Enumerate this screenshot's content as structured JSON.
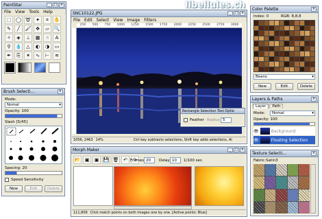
{
  "watermark": "libellules.ch",
  "paintstar": {
    "title": "PaintStar",
    "menus": [
      "File",
      "View",
      "Tools",
      "Help"
    ]
  },
  "image_window": {
    "title": "SNC10122.JPG",
    "menus": [
      "File",
      "Edit",
      "Select",
      "View",
      "Image",
      "Filters"
    ],
    "ruler": [
      "250",
      "500",
      "750",
      "1000",
      "1250",
      "1500",
      "1750",
      "2000",
      "2250",
      "2500",
      "2750",
      "3000"
    ],
    "status_coords": "1056, 2463",
    "status_zoom": "14%",
    "status_hint": "Ctrl key subtracts selections, Shift key adds selections, Al"
  },
  "rect_panel": {
    "title": "Rectangle Selection Tool Optio",
    "feather_label": "Feather",
    "radius_label": "Radius",
    "radius_value": "5"
  },
  "brush": {
    "title": "Brush Selecti...",
    "mode_label": "Mode:",
    "mode_value": "Nomal",
    "opacity_label": "Opacity: 100",
    "slash_label": "Slash [5/45]",
    "spacing_label": "Spacing: 20",
    "speed_label": "Speed Sensitivity",
    "new": "New",
    "edit": "Edit",
    "delete": "Delete"
  },
  "color_palette": {
    "title": "Color Palette",
    "index_label": "Index: 0",
    "rgb_label": "RGB: 8,8,8",
    "select_value": "Beans",
    "new": "New",
    "edit": "Edit",
    "delete": "Delete"
  },
  "layers": {
    "title": "Layers & Paths",
    "tabs": [
      "Layer",
      "Path"
    ],
    "mode_label": "Mode:",
    "mode_value": "Nomal",
    "opacity_label": "Opacity: 100",
    "items": [
      "Background",
      "Floating Selection"
    ]
  },
  "texture": {
    "title": "Texture Selecti...",
    "name": "Fabric:Satin3"
  },
  "morph": {
    "title": "Morph Maker",
    "frames_label": "Frames:",
    "frames_value": "20",
    "delay_label": "Delay:",
    "delay_value": "10",
    "delay_unit": "1/100 sec.",
    "status_coords": "111,809",
    "status_hint": "Click match points on both images one by one. [Active points: Blue]"
  }
}
